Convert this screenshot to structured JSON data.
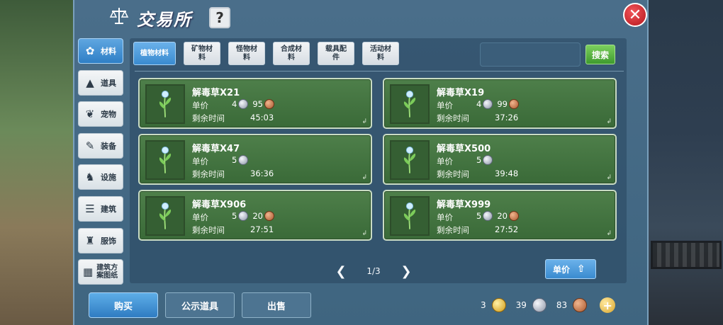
{
  "header": {
    "title": "交易所",
    "help_label": "?",
    "close_label": "✕"
  },
  "sidebar": {
    "items": [
      {
        "label": "材料",
        "icon": "materials-icon",
        "active": true
      },
      {
        "label": "道具",
        "icon": "flask-icon"
      },
      {
        "label": "宠物",
        "icon": "paw-icon"
      },
      {
        "label": "装备",
        "icon": "equipment-icon"
      },
      {
        "label": "设施",
        "icon": "facility-icon"
      },
      {
        "label": "建筑",
        "icon": "building-icon"
      },
      {
        "label": "服饰",
        "icon": "clothing-icon"
      },
      {
        "label": "建筑方案图纸",
        "icon": "blueprint-icon"
      }
    ]
  },
  "tabs": [
    {
      "label": "植物材料",
      "active": true
    },
    {
      "label": "矿物材料"
    },
    {
      "label": "怪物材料"
    },
    {
      "label": "合成材料"
    },
    {
      "label": "载具配件"
    },
    {
      "label": "活动材料"
    }
  ],
  "search": {
    "value": "",
    "placeholder": "",
    "button_label": "搜索"
  },
  "labels": {
    "price": "单价",
    "time": "剩余时间"
  },
  "listings": [
    {
      "name": "解毒草X21",
      "silver": "4",
      "copper": "95",
      "time": "45:03"
    },
    {
      "name": "解毒草X19",
      "silver": "4",
      "copper": "99",
      "time": "37:26"
    },
    {
      "name": "解毒草X47",
      "silver": "5",
      "copper": "",
      "time": "36:36"
    },
    {
      "name": "解毒草X500",
      "silver": "5",
      "copper": "",
      "time": "39:48"
    },
    {
      "name": "解毒草X906",
      "silver": "5",
      "copper": "20",
      "time": "27:51"
    },
    {
      "name": "解毒草X999",
      "silver": "5",
      "copper": "20",
      "time": "27:52"
    }
  ],
  "pager": {
    "page": "1/3"
  },
  "sort": {
    "label": "单价"
  },
  "bottom": {
    "buy_label": "购买",
    "public_label": "公示道具",
    "sell_label": "出售"
  },
  "wallet": {
    "gold": "3",
    "silver": "39",
    "copper": "83"
  },
  "colors": {
    "accent_blue": "#3a8bd0",
    "card_green": "#4e7f4a",
    "search_green": "#3e9a2e"
  }
}
